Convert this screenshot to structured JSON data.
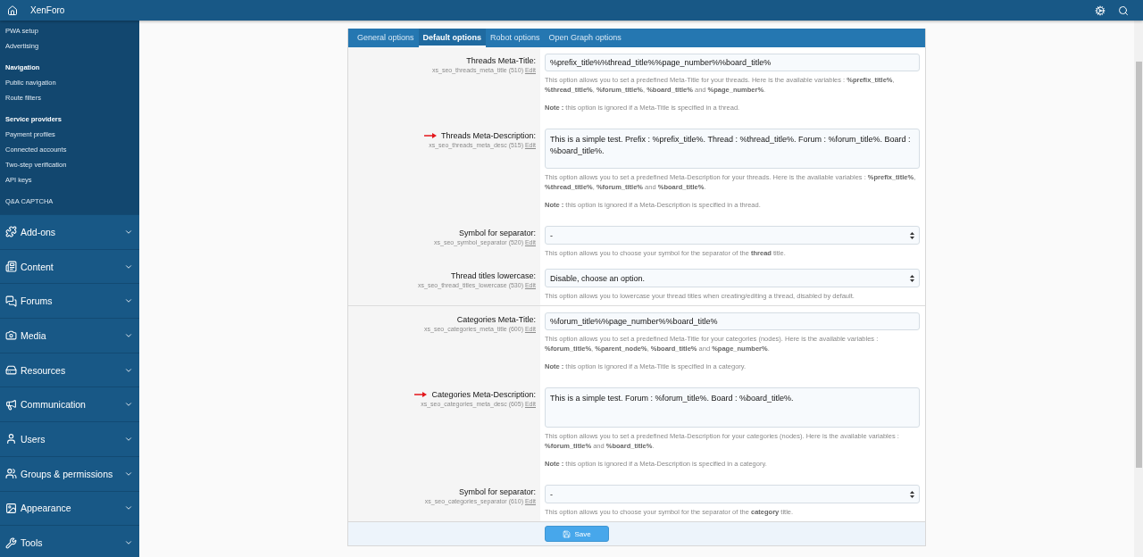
{
  "header": {
    "title": "XenForo"
  },
  "sidebar": {
    "groups": [
      {
        "items": [
          "PWA setup",
          "Advertising"
        ]
      },
      {
        "heading": "Navigation",
        "items": [
          "Public navigation",
          "Route filters"
        ]
      },
      {
        "heading": "Service providers",
        "items": [
          "Payment profiles",
          "Connected accounts",
          "Two-step verification",
          "API keys"
        ]
      },
      {
        "items": [
          "Q&A CAPTCHA"
        ]
      }
    ],
    "sections": [
      {
        "kind": "addons",
        "label": "Add-ons",
        "expanded": false
      },
      {
        "kind": "content",
        "label": "Content",
        "expanded": false
      },
      {
        "kind": "forums",
        "label": "Forums",
        "expanded": false
      },
      {
        "kind": "media",
        "label": "Media",
        "expanded": false
      },
      {
        "kind": "resources",
        "label": "Resources",
        "expanded": false
      },
      {
        "kind": "communication",
        "label": "Communication",
        "expanded": false
      },
      {
        "kind": "users",
        "label": "Users",
        "expanded": false
      },
      {
        "kind": "groups",
        "label": "Groups & permissions",
        "expanded": false
      },
      {
        "kind": "appearance",
        "label": "Appearance",
        "expanded": false
      },
      {
        "kind": "tools",
        "label": "Tools",
        "expanded": false
      }
    ]
  },
  "tabs": [
    {
      "label": "General options",
      "selected": false
    },
    {
      "label": "Default options",
      "selected": true
    },
    {
      "label": "Robot options",
      "selected": false
    },
    {
      "label": "Open Graph options",
      "selected": false
    }
  ],
  "form": {
    "groups": [
      {
        "rows": [
          {
            "label": "Threads Meta-Title:",
            "arrow": false,
            "option_id": "xs_seo_threads_meta_title (510)",
            "edit": "Edit",
            "kind": "text",
            "value": "%prefix_title%%thread_title%%page_number%%board_title%",
            "explanation": "This option allows you to set a predefined Meta-Title for your threads. Here is the available variables : **%prefix_title%**, **%thread_title%**, **%forum_title%**, **%board_title%** and **%page_number%**.",
            "note": "**Note :** this option is ignored if a Meta-Title is specified in a thread."
          },
          {
            "label": "Threads Meta-Description:",
            "arrow": true,
            "option_id": "xs_seo_threads_meta_desc (515)",
            "edit": "Edit",
            "kind": "textarea",
            "value": "This is a simple test. Prefix : %prefix_title%. Thread : %thread_title%. Forum : %forum_title%. Board : %board_title%.",
            "explanation": "This option allows you to set a predefined Meta-Description for your threads. Here is the available variables : **%prefix_title%**, **%thread_title%**, **%forum_title%** and **%board_title%**.",
            "note": "**Note :** this option is ignored if a Meta-Description is specified in a thread."
          },
          {
            "label": "Symbol for separator:",
            "arrow": false,
            "option_id": "xs_seo_symbol_separator (520)",
            "edit": "Edit",
            "kind": "select",
            "value": "-",
            "explanation": "This option allows you to choose your symbol for the separator of the **thread** title."
          },
          {
            "label": "Thread titles lowercase:",
            "arrow": false,
            "option_id": "xs_seo_thread_titles_lowercase (530)",
            "edit": "Edit",
            "kind": "select",
            "value": "Disable, choose an option.",
            "explanation": "This option allows you to lowercase your thread titles when creating/editing a thread, disabled by default."
          }
        ]
      },
      {
        "rows": [
          {
            "label": "Categories Meta-Title:",
            "arrow": false,
            "option_id": "xs_seo_categories_meta_title (600)",
            "edit": "Edit",
            "kind": "text",
            "value": "%forum_title%%page_number%%board_title%",
            "explanation": "This option allows you to set a predefined Meta-Title for your categories (nodes). Here is the available variables : **%forum_title%**, **%parent_node%**, **%board_title%** and **%page_number%**.",
            "note": "**Note :** this option is ignored if a Meta-Title is specified in a category."
          },
          {
            "label": "Categories Meta-Description:",
            "arrow": true,
            "option_id": "xs_seo_categories_meta_desc (605)",
            "edit": "Edit",
            "kind": "textarea",
            "value": "This is a simple test. Forum : %forum_title%. Board : %board_title%.",
            "explanation": "This option allows you to set a predefined Meta-Description for your categories (nodes). Here is the available variables : **%forum_title%** and **%board_title%**.",
            "note": "**Note :** this option is ignored if a Meta-Description is specified in a category."
          },
          {
            "label": "Symbol for separator:",
            "arrow": false,
            "option_id": "xs_seo_categories_separator (610)",
            "edit": "Edit",
            "kind": "select",
            "value": "-",
            "explanation": "This option allows you to choose your symbol for the separator of the **category** title."
          }
        ]
      }
    ]
  },
  "save": {
    "label": "Save"
  }
}
